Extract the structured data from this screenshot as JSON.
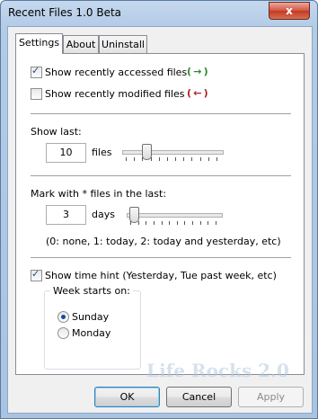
{
  "window": {
    "title": "Recent Files 1.0 Beta",
    "close_glyph": "x"
  },
  "tabs": [
    {
      "label": "Settings"
    },
    {
      "label": "About"
    },
    {
      "label": "Uninstall"
    }
  ],
  "settings": {
    "show_accessed": {
      "label": "Show recently accessed files",
      "checked": true,
      "icon": "( → )"
    },
    "show_modified": {
      "label": "Show recently modified files",
      "checked": false,
      "icon": "( ← )"
    },
    "show_last": {
      "label": "Show last:",
      "value": "10",
      "unit": "files",
      "slider_level": 0.22
    },
    "mark_with": {
      "label": "Mark with * files in the last:",
      "value": "3",
      "unit": "days",
      "slider_level": 0.03,
      "hint": "(0: none, 1: today, 2: today and yesterday, etc)"
    },
    "time_hint": {
      "label": "Show time hint (Yesterday, Tue past week, etc)",
      "checked": true
    },
    "week_starts": {
      "title": "Week starts on:",
      "options": [
        {
          "label": "Sunday",
          "selected": true
        },
        {
          "label": "Monday",
          "selected": false
        }
      ]
    }
  },
  "buttons": {
    "ok": "OK",
    "cancel": "Cancel",
    "apply": "Apply"
  },
  "watermark": "Life Rocks 2.0"
}
